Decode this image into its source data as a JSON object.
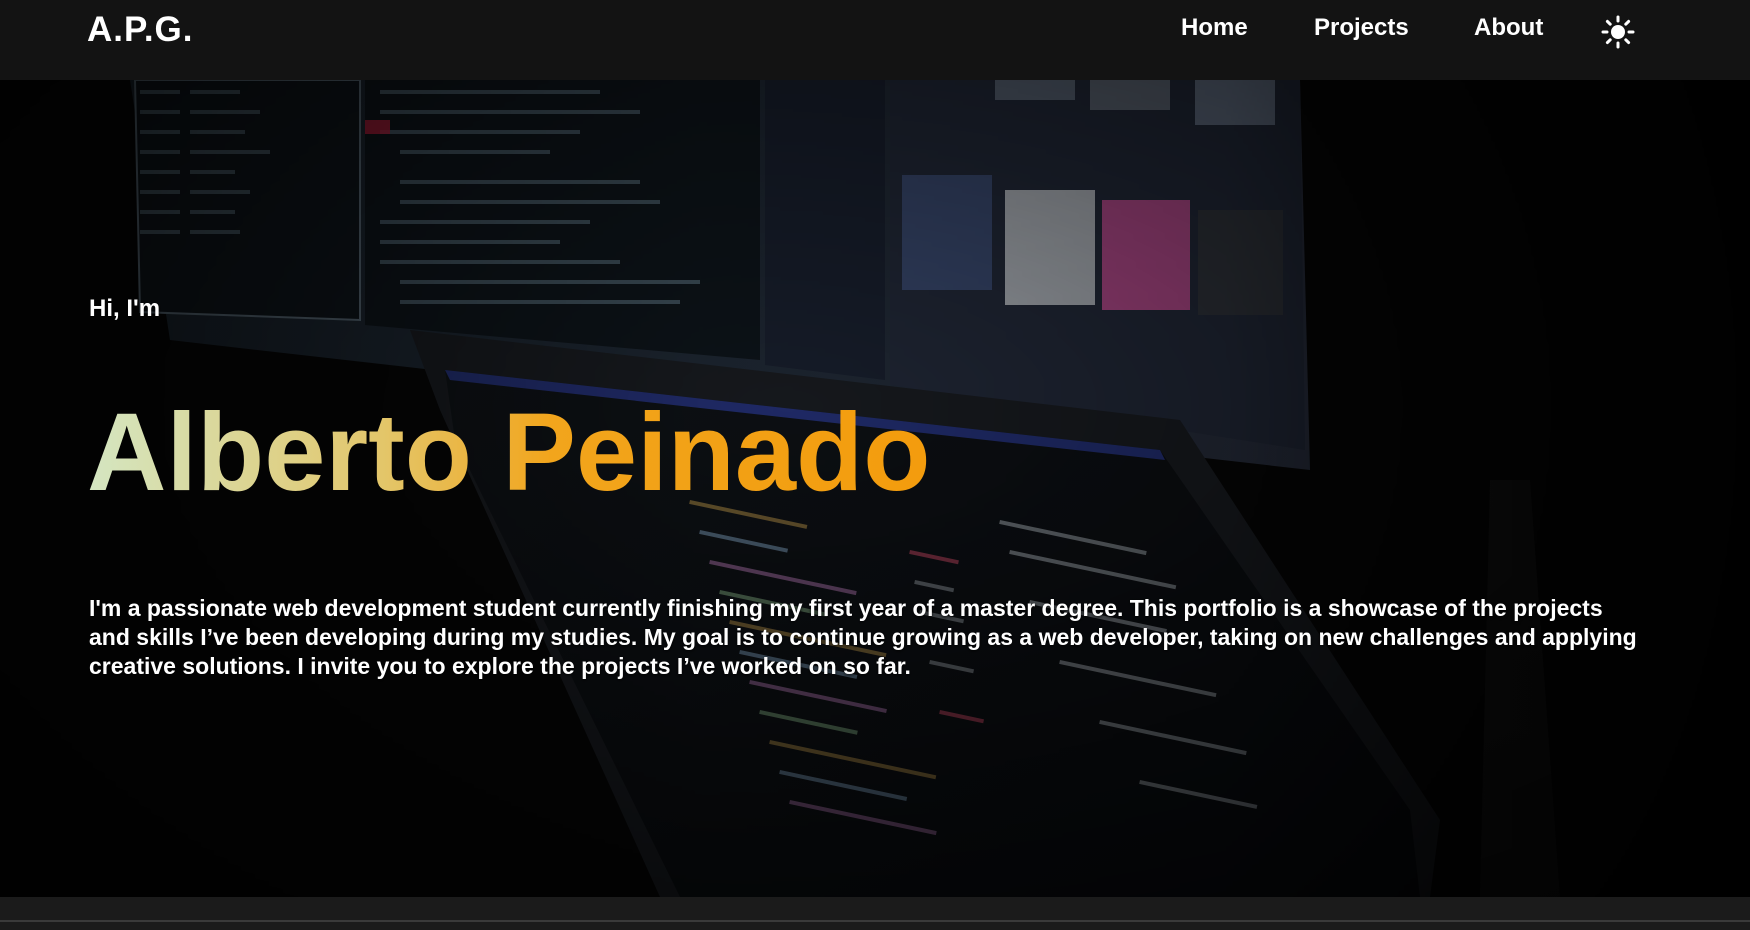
{
  "header": {
    "brand": "A.P.G.",
    "nav": {
      "home": "Home",
      "projects": "Projects",
      "about": "About"
    },
    "theme_toggle_icon": "sun-icon"
  },
  "hero": {
    "greeting": "Hi, I'm",
    "name": "Alberto Peinado",
    "description": "I'm a passionate web development student currently finishing my first year of a master degree. This portfolio is a showcase of the projects and skills I’ve been developing during my studies. My goal is to continue growing as a web developer, taking on new challenges and applying creative solutions. I invite you to explore the projects I’ve worked on so far.",
    "background_image": "photo of laptop and monitor displaying code",
    "name_gradient": [
      "#d4e6c2",
      "#e3c66a",
      "#f2a51c",
      "#f39c0d"
    ]
  },
  "colors": {
    "navbar_bg": "#131313",
    "page_bg": "#0d0d0d",
    "accent": "#f39c0d"
  }
}
